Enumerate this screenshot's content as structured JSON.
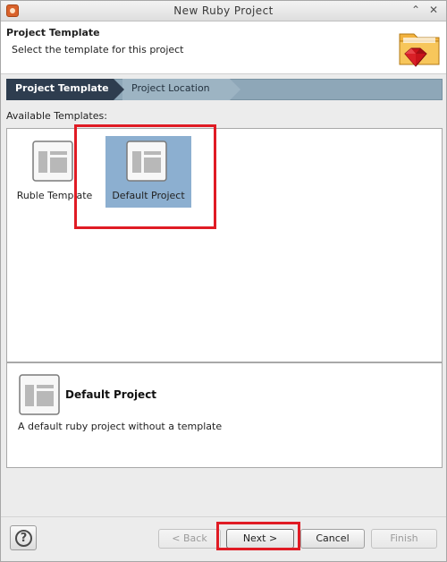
{
  "window": {
    "title": "New Ruby Project",
    "controls": {
      "restore": "⌃",
      "close": "✕"
    }
  },
  "header": {
    "title": "Project Template",
    "description": "Select the template for this project",
    "icon": "ruby-folder-icon"
  },
  "steps": [
    {
      "label": "Project Template",
      "active": true
    },
    {
      "label": "Project Location",
      "active": false
    }
  ],
  "templates": {
    "label": "Available Templates:",
    "items": [
      {
        "label": "Ruble Template",
        "icon": "template-layout-icon",
        "selected": false
      },
      {
        "label": "Default Project",
        "icon": "template-layout-icon",
        "selected": true
      }
    ]
  },
  "details": {
    "title": "Default Project",
    "description": "A default ruby project without a template",
    "icon": "template-layout-icon"
  },
  "footer": {
    "help_label": "?",
    "back_label": "< Back",
    "next_label": "Next >",
    "cancel_label": "Cancel",
    "finish_label": "Finish"
  },
  "colors": {
    "highlight": "#e01b24",
    "selection": "#8cafd0",
    "step_active": "#2e3d4f",
    "step_inactive": "#8ea7b8"
  }
}
